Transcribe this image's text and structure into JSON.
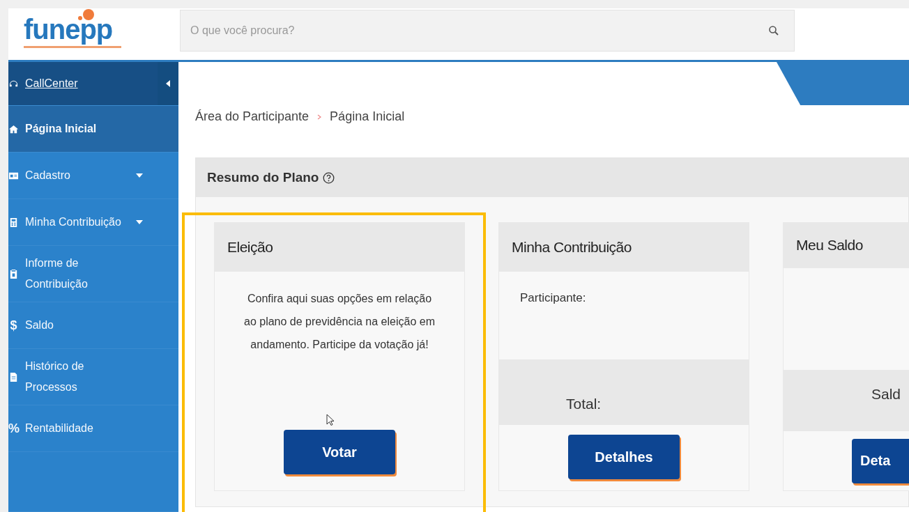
{
  "header": {
    "logo": "funepp",
    "search": {
      "placeholder": "O que você procura?"
    }
  },
  "sidebar": {
    "items": [
      {
        "label": "CallCenter",
        "link": true,
        "selected": false,
        "expandable": false,
        "collapse_toggle": true
      },
      {
        "label": "Página Inicial",
        "link": false,
        "selected": true,
        "expandable": false,
        "collapse_toggle": false
      },
      {
        "label": "Cadastro",
        "link": false,
        "selected": false,
        "expandable": true,
        "collapse_toggle": false
      },
      {
        "label": "Minha Contribuição",
        "link": false,
        "selected": false,
        "expandable": true,
        "collapse_toggle": false
      },
      {
        "label": "Informe de Contribuição",
        "link": false,
        "selected": false,
        "expandable": false,
        "collapse_toggle": false
      },
      {
        "label": "Saldo",
        "symbol": "$",
        "link": false,
        "selected": false,
        "expandable": false,
        "collapse_toggle": false
      },
      {
        "label": "Histórico de Processos",
        "link": false,
        "selected": false,
        "expandable": false,
        "collapse_toggle": false
      },
      {
        "label": "Rentabilidade",
        "symbol": "%",
        "link": false,
        "selected": false,
        "expandable": false,
        "collapse_toggle": false
      }
    ]
  },
  "breadcrumb": [
    "Área do Participante",
    "Página Inicial"
  ],
  "panel": {
    "title": "Resumo do Plano",
    "cards": [
      {
        "kind": "text",
        "title": "Eleição",
        "body": "Confira aqui suas opções em relação ao plano de previdência na eleição em andamento. Participe da votação já!",
        "button": "Votar",
        "highlighted": true
      },
      {
        "kind": "summary",
        "title": "Minha Contribuição",
        "label": "Participante:",
        "footer_label": "Total:",
        "button": "Detalhes",
        "highlighted": false
      },
      {
        "kind": "summary",
        "title": "Meu Saldo",
        "footer_label": "Sald",
        "button": "Deta",
        "highlighted": false
      }
    ]
  }
}
